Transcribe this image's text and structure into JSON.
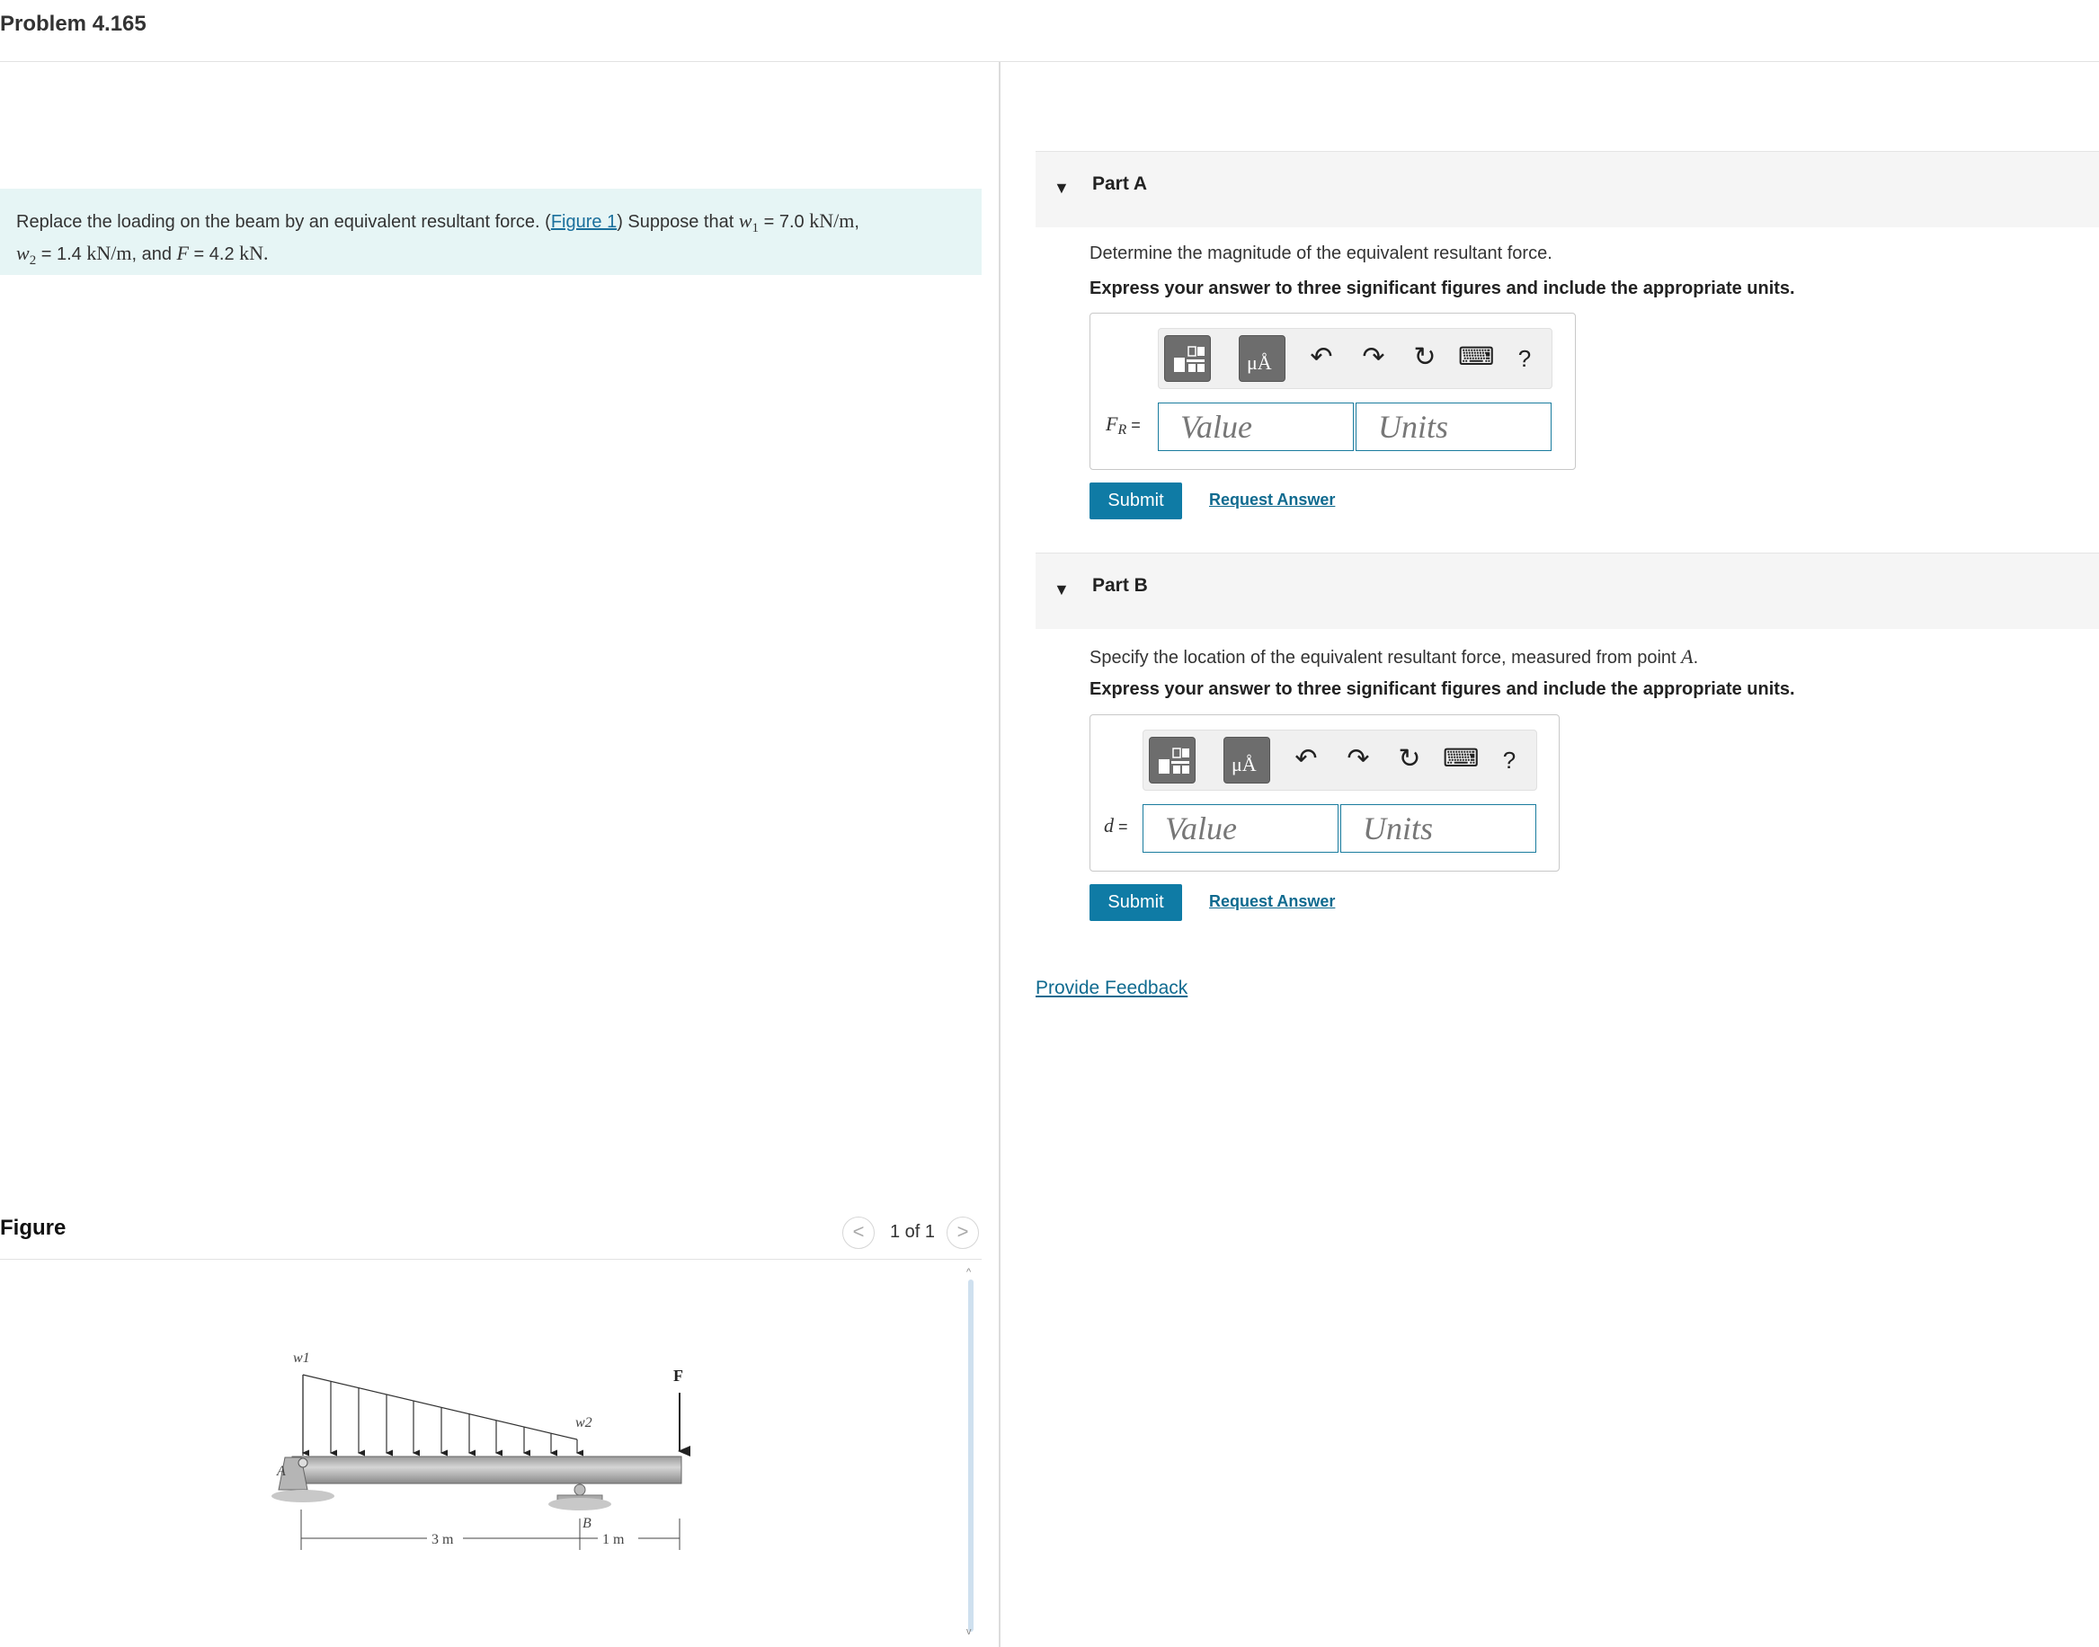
{
  "title": "Problem 4.165",
  "problem": {
    "text_1": "Replace the loading on the beam by an equivalent resultant force. (",
    "figure_link": "Figure 1",
    "text_2": ") Suppose that ",
    "w1_sym": "w",
    "w1_sub": "1",
    "eq": " = ",
    "w1_val": "7.0 ",
    "w1_unit": "kN/m",
    "comma": ",",
    "w2_sym": "w",
    "w2_sub": "2",
    "w2_val": "1.4 ",
    "w2_unit": "kN/m",
    "and": ", and ",
    "f_sym": "F",
    "f_val": "4.2 ",
    "f_unit": "kN",
    "end": "."
  },
  "figure": {
    "label": "Figure",
    "pager": "1 of 1",
    "prev": "<",
    "next": ">",
    "scroll_up": "^",
    "scroll_down": "v",
    "diagram": {
      "w1": "w1",
      "w2": "w2",
      "force": "F",
      "point_a": "A",
      "point_b": "B",
      "dim_left": "3 m",
      "dim_right": "1 m"
    }
  },
  "toolbar": {
    "undo": "↶",
    "redo": "↷",
    "reset": "↻",
    "keyboard": "⌨",
    "help": "?",
    "units_glyph": "μÅ"
  },
  "part_a": {
    "caret": "▼",
    "title": "Part A",
    "question": "Determine the magnitude of the equivalent resultant force.",
    "instruction": "Express your answer to three significant figures and include the appropriate units.",
    "label_var": "F",
    "label_sub": "R",
    "label_eq": " =",
    "value_placeholder": "Value",
    "units_placeholder": "Units",
    "submit": "Submit",
    "request": "Request Answer"
  },
  "part_b": {
    "caret": "▼",
    "title": "Part B",
    "question_pre": "Specify the location of the equivalent resultant force, measured from point ",
    "question_point": "A",
    "question_end": ".",
    "instruction": "Express your answer to three significant figures and include the appropriate units.",
    "label_var": "d",
    "label_eq": " =",
    "value_placeholder": "Value",
    "units_placeholder": "Units",
    "submit": "Submit",
    "request": "Request Answer"
  },
  "feedback": "Provide Feedback"
}
